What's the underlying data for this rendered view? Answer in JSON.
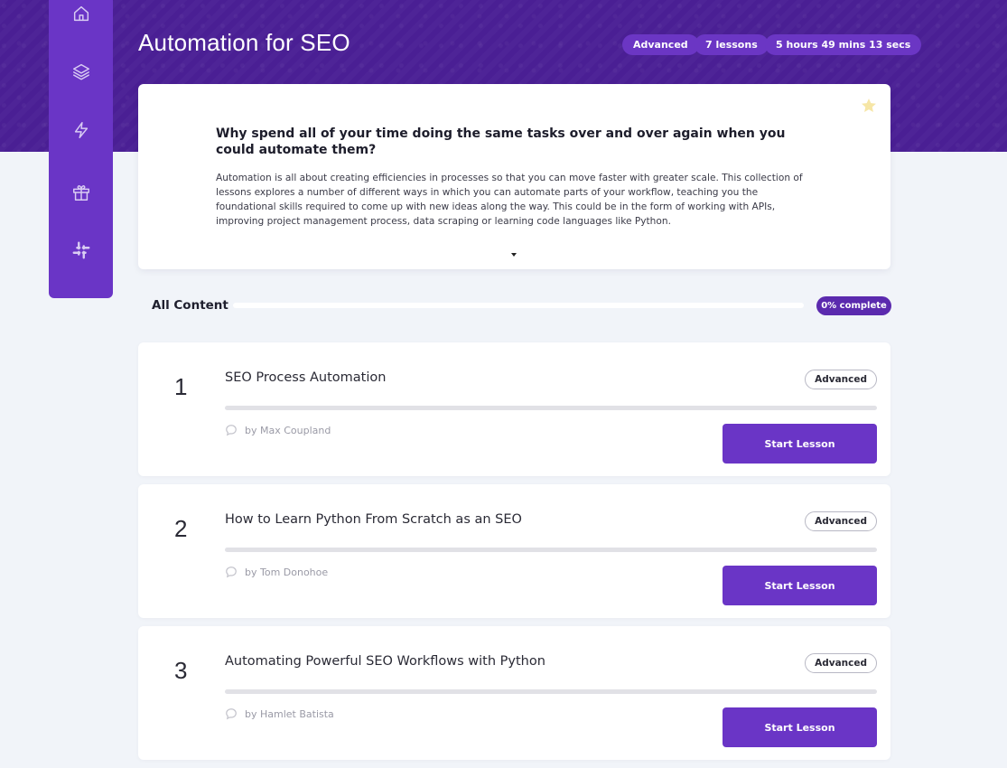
{
  "sidebar": {
    "items": [
      {
        "icon": "home-icon"
      },
      {
        "icon": "layers-icon"
      },
      {
        "icon": "lightning-icon"
      },
      {
        "icon": "gift-icon"
      },
      {
        "icon": "slack-icon"
      }
    ]
  },
  "header": {
    "title": "Automation for SEO",
    "level": "Advanced",
    "lessons": "7 lessons",
    "duration": "5 hours 49 mins 13 secs"
  },
  "intro": {
    "heading": "Why spend all of your time doing the same tasks over and over again when you could automate them?",
    "body": "Automation is all about creating efficiencies in processes so that you can move faster with greater scale. This collection of lessons explores a number of different ways in which you can automate parts of your workflow, teaching you the foundational skills required to come up with new ideas along the way. This could be in the form of working with APIs, improving project management process, data scraping or learning code languages like Python.",
    "star_color": "#f6e6a6"
  },
  "progress": {
    "label": "All Content",
    "complete_text": "0% complete",
    "fraction": 0
  },
  "lessons": [
    {
      "number": "1",
      "title": "SEO Process Automation",
      "level": "Advanced",
      "author": "by Max Coupland",
      "button": "Start Lesson",
      "progress": 0
    },
    {
      "number": "2",
      "title": "How to Learn Python From Scratch as an SEO",
      "level": "Advanced",
      "author": "by Tom Donohoe",
      "button": "Start Lesson",
      "progress": 0
    },
    {
      "number": "3",
      "title": "Automating Powerful SEO Workflows with Python",
      "level": "Advanced",
      "author": "by Hamlet Batista",
      "button": "Start Lesson",
      "progress": 0
    }
  ],
  "colors": {
    "brand": "#6a35c6",
    "hero": "#4a1f94",
    "background": "#f1f4f9"
  }
}
